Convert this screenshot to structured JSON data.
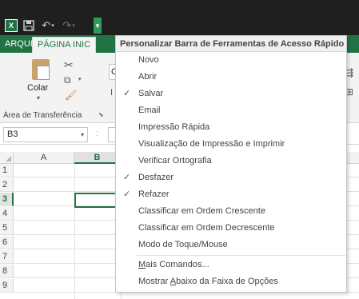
{
  "app": {
    "logo": "X",
    "logo_icon": "excel-logo-icon"
  },
  "tabs": {
    "arquivo": "ARQUIVO",
    "pagina": "PÁGINA INIC"
  },
  "ribbon": {
    "paste_label": "Colar",
    "clipboard_group": "Área de Transferência",
    "font_box_text": "C",
    "font_box2": "I"
  },
  "formula_bar": {
    "namebox": "B3",
    "separator": ":"
  },
  "grid": {
    "columns": [
      "A",
      "B"
    ],
    "rows": [
      "1",
      "2",
      "3",
      "4",
      "5",
      "6",
      "7",
      "8",
      "9"
    ],
    "selected_column": "B",
    "selected_row": "3"
  },
  "qat_menu": {
    "header": "Personalizar Barra de Ferramentas de Acesso Rápido",
    "items": [
      {
        "label": "Novo",
        "checked": false
      },
      {
        "label": "Abrir",
        "checked": false
      },
      {
        "label": "Salvar",
        "checked": true
      },
      {
        "label": "Email",
        "checked": false
      },
      {
        "label": "Impressão Rápida",
        "checked": false
      },
      {
        "label": "Visualização de Impressão e Imprimir",
        "checked": false
      },
      {
        "label": "Verificar Ortografia",
        "checked": false
      },
      {
        "label": "Desfazer",
        "checked": true
      },
      {
        "label": "Refazer",
        "checked": true
      },
      {
        "label": "Classificar em Ordem Crescente",
        "checked": false
      },
      {
        "label": "Classificar em Ordem Decrescente",
        "checked": false
      },
      {
        "label": "Modo de Toque/Mouse",
        "checked": false
      }
    ],
    "more_commands_prefix": "",
    "more_commands_underlined": "M",
    "more_commands_rest": "ais Comandos...",
    "show_below_prefix": "Mostrar ",
    "show_below_underlined": "A",
    "show_below_rest": "baixo da Faixa de Opções"
  },
  "colors": {
    "accent": "#217346",
    "titlebar": "#1f1f1f"
  }
}
